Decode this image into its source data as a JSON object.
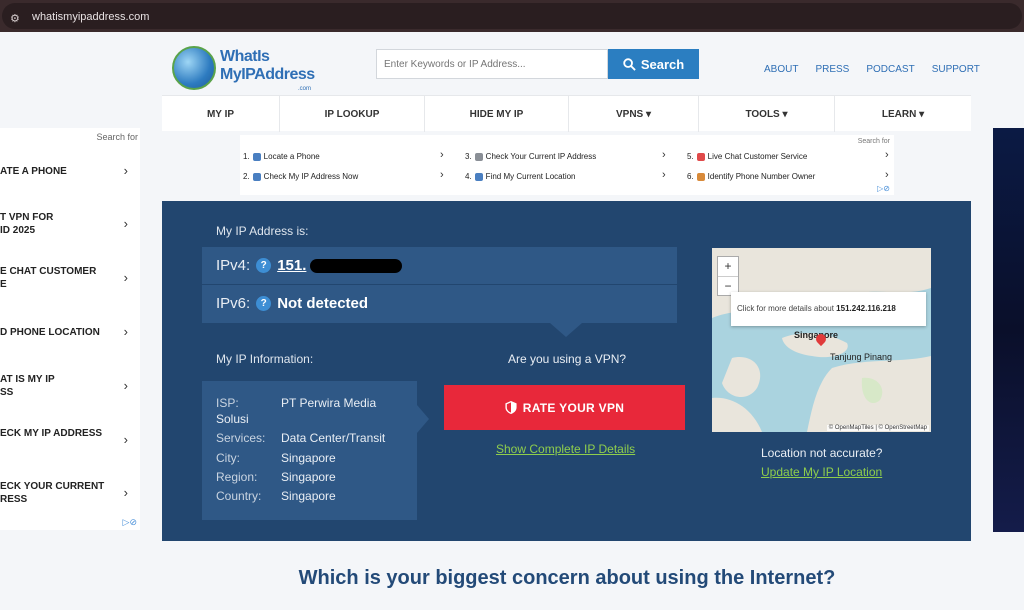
{
  "browser": {
    "url": "whatismyipaddress.com"
  },
  "header": {
    "logo": {
      "line1": "WhatIs",
      "line2": "MyIPAddress",
      "line3": ".com"
    },
    "search_placeholder": "Enter Keywords or IP Address...",
    "search_button": "Search",
    "links": [
      "ABOUT",
      "PRESS",
      "PODCAST",
      "SUPPORT"
    ]
  },
  "nav": [
    "MY IP",
    "IP LOOKUP",
    "HIDE MY IP",
    "VPNS ▾",
    "TOOLS ▾",
    "LEARN ▾"
  ],
  "top_ad": {
    "search_for": "Search for",
    "items": [
      {
        "n": "1.",
        "label": "Locate a Phone"
      },
      {
        "n": "2.",
        "label": "Check My IP Address Now"
      },
      {
        "n": "3.",
        "label": "Check Your Current IP Address"
      },
      {
        "n": "4.",
        "label": "Find My Current Location"
      },
      {
        "n": "5.",
        "label": "Live Chat Customer Service"
      },
      {
        "n": "6.",
        "label": "Identify Phone Number Owner"
      }
    ],
    "icon_colors": [
      "#4a7fc1",
      "#4a7fc1",
      "#8a8f96",
      "#4a7fc1",
      "#e04a4a",
      "#d88a3a"
    ]
  },
  "left_ad": {
    "search_for": "Search for",
    "items": [
      "ATE A PHONE",
      "T VPN FOR\nID 2025",
      "E CHAT CUSTOMER\nE",
      "D PHONE LOCATION",
      "AT IS MY IP\nSS",
      "ECK MY IP ADDRESS",
      "ECK YOUR CURRENT\nRESS"
    ]
  },
  "panel": {
    "my_ip_label": "My IP Address is:",
    "ipv4_label": "IPv4:",
    "ipv4_value": "151.",
    "ipv6_label": "IPv6:",
    "ipv6_value": "Not detected",
    "help": "?",
    "info_label": "My IP Information:",
    "info": {
      "isp_k": "ISP:",
      "isp_v": "PT Perwira Media",
      "isp_v2": "Solusi",
      "services_k": "Services:",
      "services_v": "Data Center/Transit",
      "city_k": "City:",
      "city_v": "Singapore",
      "region_k": "Region:",
      "region_v": "Singapore",
      "country_k": "Country:",
      "country_v": "Singapore"
    },
    "vpn_question": "Are you using a VPN?",
    "rate_button": "RATE YOUR VPN",
    "show_details": "Show Complete IP Details",
    "map": {
      "zoom_in": "+",
      "zoom_out": "−",
      "tooltip_prefix": "Click for more details about",
      "tooltip_ip": "151.242.116.218",
      "city1": "Singapore",
      "city2": "Tanjung Pinang",
      "attribution": "© OpenMapTiles | © OpenStreetMap"
    },
    "loc_question": "Location not accurate?",
    "loc_update": "Update My IP Location"
  },
  "concern_question": "Which is your biggest concern about using the Internet?",
  "colors": {
    "panel": "#22466f",
    "box": "#2f5886",
    "accent": "#2b7ec1",
    "cta": "#e8283a",
    "link_green": "#8fce4c"
  }
}
